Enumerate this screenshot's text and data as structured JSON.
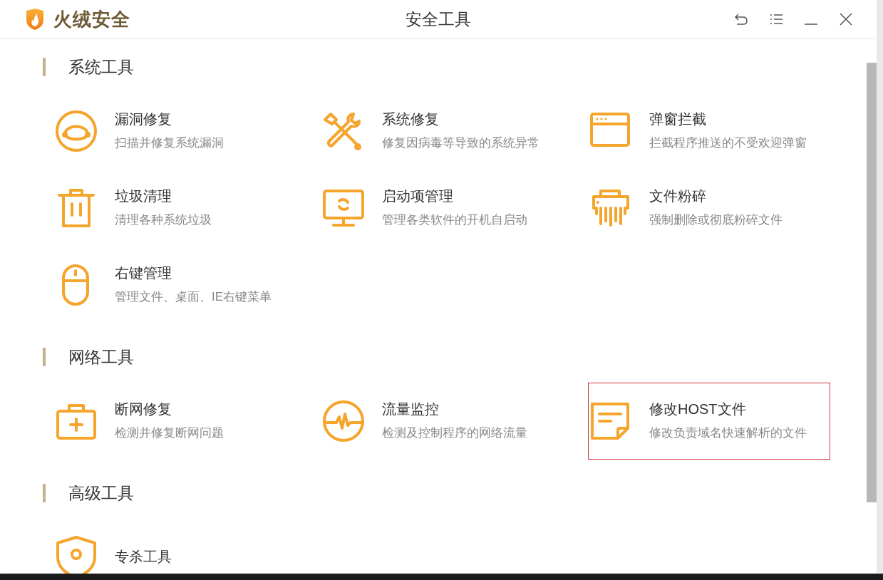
{
  "window": {
    "logo_text": "火绒安全",
    "title": "安全工具"
  },
  "sections": [
    {
      "title": "系统工具",
      "tools": [
        {
          "name": "漏洞修复",
          "description": "扫描并修复系统漏洞",
          "selected": false
        },
        {
          "name": "系统修复",
          "description": "修复因病毒等导致的系统异常",
          "selected": false
        },
        {
          "name": "弹窗拦截",
          "description": "拦截程序推送的不受欢迎弹窗",
          "selected": false
        },
        {
          "name": "垃圾清理",
          "description": "清理各种系统垃圾",
          "selected": false
        },
        {
          "name": "启动项管理",
          "description": "管理各类软件的开机自启动",
          "selected": false
        },
        {
          "name": "文件粉碎",
          "description": "强制删除或彻底粉碎文件",
          "selected": false
        },
        {
          "name": "右键管理",
          "description": "管理文件、桌面、IE右键菜单",
          "selected": false
        }
      ]
    },
    {
      "title": "网络工具",
      "tools": [
        {
          "name": "断网修复",
          "description": "检测并修复断网问题",
          "selected": false
        },
        {
          "name": "流量监控",
          "description": "检测及控制程序的网络流量",
          "selected": false
        },
        {
          "name": "修改HOST文件",
          "description": "修改负责域名快速解析的文件",
          "selected": true
        }
      ]
    },
    {
      "title": "高级工具",
      "tools": [
        {
          "name": "专杀工具",
          "selected": false
        }
      ]
    }
  ]
}
